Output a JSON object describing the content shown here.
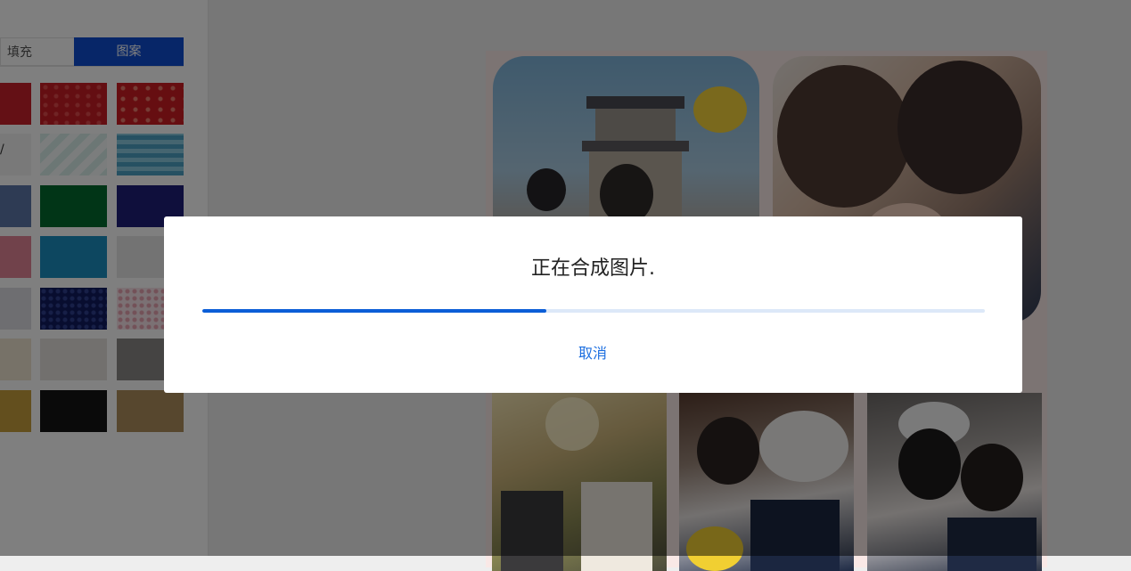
{
  "sidebar": {
    "tabs": [
      {
        "label": "填充",
        "active": false
      },
      {
        "label": "图案",
        "active": true
      }
    ],
    "swatch_colors": {
      "red": "#cc1c22",
      "green": "#036b2e",
      "navy": "#1e1f78",
      "blue_gray": "#5c77a8",
      "teal": "#1b8fc0",
      "black": "#151515",
      "gold": "#c79f3d",
      "tan": "#ae8e5c"
    }
  },
  "dialog": {
    "title": "正在合成图片.",
    "progress": 0.44,
    "cancel_label": "取消"
  },
  "colors": {
    "accent": "#0b5ed7",
    "link": "#1d6fe0",
    "tab_active": "#0f4dd0"
  }
}
